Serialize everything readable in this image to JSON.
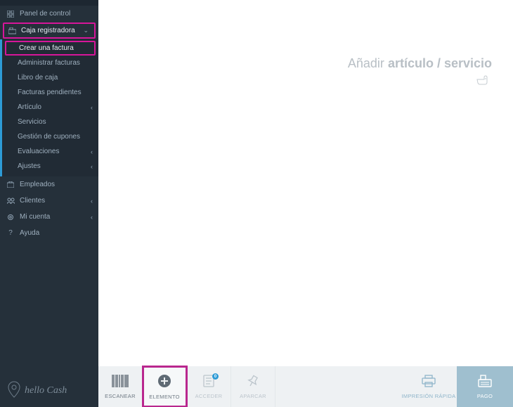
{
  "sidebar": {
    "panel_control": "Panel de control",
    "cash_register": "Caja registradora",
    "sub": {
      "create_invoice": "Crear una factura",
      "manage_invoices": "Administrar facturas",
      "cash_book": "Libro de caja",
      "pending_invoices": "Facturas pendientes",
      "article": "Artículo",
      "services": "Servicios",
      "coupon_mgmt": "Gestión de cupones",
      "evaluations": "Evaluaciones",
      "settings": "Ajustes"
    },
    "employees": "Empleados",
    "clients": "Clientes",
    "my_account": "Mi cuenta",
    "help": "Ayuda",
    "logo_text": "hello Cash"
  },
  "main": {
    "add_prefix": "Añadir ",
    "add_strong": "artículo / servicio"
  },
  "bottombar": {
    "scan": "ESCANEAR",
    "element": "ELEMENTO",
    "access": "ACCEDER",
    "park": "APARCAR",
    "access_badge": "0",
    "quick_print": "IMPRESIÓN RÁPIDA",
    "pay": "PAGO"
  }
}
